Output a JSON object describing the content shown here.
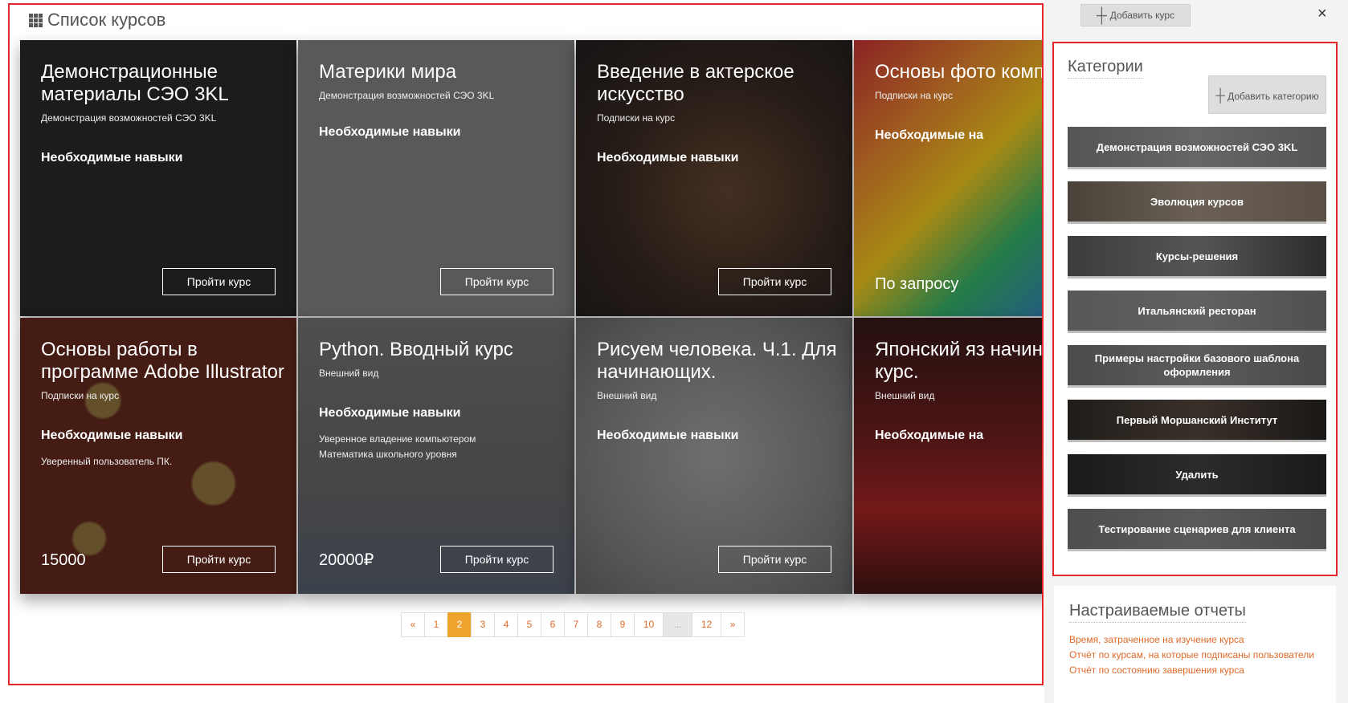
{
  "main": {
    "title": "Список курсов",
    "cards": [
      {
        "title": "Демонстрационные материалы СЭО 3KL",
        "subtitle": "Демонстрация возможностей СЭО 3KL",
        "skills_heading": "Необходимые навыки",
        "skills": [],
        "price": "",
        "button": "Пройти курс"
      },
      {
        "title": "Материки мира",
        "subtitle": "Демонстрация возможностей СЭО 3KL",
        "skills_heading": "Необходимые навыки",
        "skills": [],
        "price": "",
        "button": "Пройти курс"
      },
      {
        "title": "Введение в актерское искусство",
        "subtitle": "Подписки на курс",
        "skills_heading": "Необходимые навыки",
        "skills": [],
        "price": "",
        "button": "Пройти курс"
      },
      {
        "title": "Основы фото композиции",
        "subtitle": "Подписки на курс",
        "skills_heading": "Необходимые на",
        "skills": [],
        "price": "По запросу",
        "button": ""
      },
      {
        "title": "Основы работы в программе Adobe Illustrator",
        "subtitle": "Подписки на курс",
        "skills_heading": "Необходимые навыки",
        "skills": [
          "Уверенный пользователь ПК."
        ],
        "price": "15000",
        "button": "Пройти курс"
      },
      {
        "title": "Python. Вводный курс",
        "subtitle": "Внешний вид",
        "skills_heading": "Необходимые навыки",
        "skills": [
          "Уверенное владение компьютером",
          "Математика школьного уровня"
        ],
        "price": "20000₽",
        "button": "Пройти курс"
      },
      {
        "title": "Рисуем человека. Ч.1. Для начинающих.",
        "subtitle": "Внешний вид",
        "skills_heading": "Необходимые навыки",
        "skills": [],
        "price": "",
        "button": "Пройти курс"
      },
      {
        "title": "Японский яз начинающих курс.",
        "subtitle": "Внешний вид",
        "skills_heading": "Необходимые на",
        "skills": [],
        "price": "",
        "button": ""
      }
    ],
    "pagination": {
      "prev": "«",
      "pages": [
        "1",
        "2",
        "3",
        "4",
        "5",
        "6",
        "7",
        "8",
        "9",
        "10"
      ],
      "dots": "...",
      "last": "12",
      "next": "»",
      "active": "2"
    }
  },
  "right": {
    "add_course": "Добавить курс",
    "close": "×",
    "categories": {
      "title": "Категории",
      "add_label": "Добавить категорию",
      "items": [
        "Демонстрация возможностей СЭО 3KL",
        "Эволюция курсов",
        "Курсы-решения",
        "Итальянский ресторан",
        "Примеры настройки базового шаблона оформления",
        "Первый Моршанский Институт",
        "Удалить",
        "Тестирование сценариев для клиента"
      ]
    },
    "reports": {
      "title": "Настраиваемые отчеты",
      "links": [
        "Время, затраченное на изучение курса",
        "Отчёт по курсам, на которые подписаны пользователи",
        "Отчёт по состоянию завершения курса"
      ]
    }
  }
}
